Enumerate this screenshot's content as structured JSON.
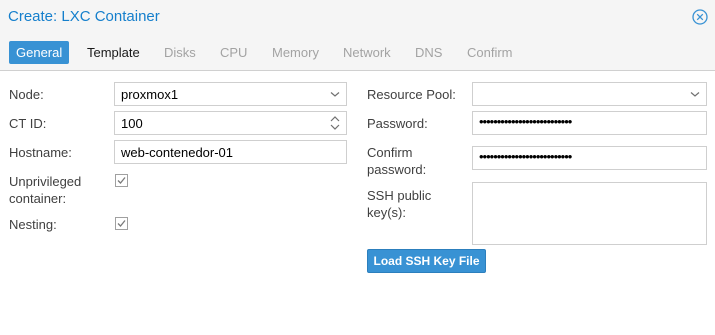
{
  "window": {
    "title": "Create: LXC Container"
  },
  "icons": {
    "close": "close-circle-icon",
    "dropdown": "chevron-down-icon",
    "spinner": "spinner-arrows-icon",
    "check": "check-icon"
  },
  "colors": {
    "accent": "#3892d4",
    "title": "#157fcc"
  },
  "tabs": [
    {
      "label": "General",
      "state": "active"
    },
    {
      "label": "Template",
      "state": "enabled"
    },
    {
      "label": "Disks",
      "state": "disabled"
    },
    {
      "label": "CPU",
      "state": "disabled"
    },
    {
      "label": "Memory",
      "state": "disabled"
    },
    {
      "label": "Network",
      "state": "disabled"
    },
    {
      "label": "DNS",
      "state": "disabled"
    },
    {
      "label": "Confirm",
      "state": "disabled"
    }
  ],
  "form": {
    "node": {
      "label": "Node:",
      "value": "proxmox1"
    },
    "ct_id": {
      "label": "CT ID:",
      "value": "100"
    },
    "hostname": {
      "label": "Hostname:",
      "value": "web-contenedor-01"
    },
    "unprivileged": {
      "label_line1": "Unprivileged",
      "label_line2": "container:",
      "checked": true
    },
    "nesting": {
      "label": "Nesting:",
      "checked": true
    },
    "resource_pool": {
      "label": "Resource Pool:",
      "value": ""
    },
    "password": {
      "label": "Password:",
      "value": "••••••••••••••••••••••••••"
    },
    "confirm_password": {
      "label_line1": "Confirm",
      "label_line2": "password:",
      "value": "••••••••••••••••••••••••••"
    },
    "ssh_keys": {
      "label_line1": "SSH public",
      "label_line2": "key(s):",
      "value": ""
    },
    "load_ssh_button": "Load SSH Key File"
  }
}
